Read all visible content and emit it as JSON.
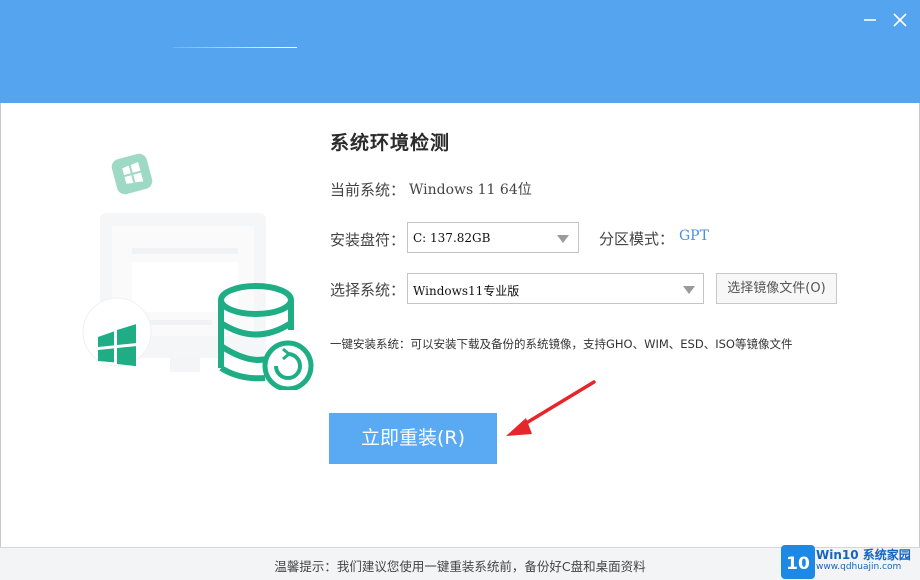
{
  "window": {
    "minimize_icon": "minimize-icon",
    "close_icon": "close-icon",
    "accent_color": "#55a4f0"
  },
  "main": {
    "heading": "系统环境检测",
    "current_system_label": "当前系统：",
    "current_system_value": "Windows 11 64位",
    "install_disk_label": "安装盘符：",
    "install_disk_value": "C: 137.82GB",
    "partition_mode_label": "分区模式：",
    "partition_mode_value": "GPT",
    "select_system_label": "选择系统：",
    "select_system_value": "Windows11专业版",
    "select_image_button": "选择镜像文件(O)",
    "one_click_note": "一键安装系统：可以安装下载及备份的系统镜像，支持GHO、WIM、ESD、ISO等镜像文件",
    "reinstall_button": "立即重装(R)",
    "button_color": "#5aaaf3"
  },
  "footer": {
    "tip": "温馨提示：我们建议您使用一键重装系统前，备份好C盘和桌面资料"
  },
  "watermark": {
    "logo_text": "10",
    "title": "Win10 系统家园",
    "url": "www.qdhuajin.com"
  }
}
